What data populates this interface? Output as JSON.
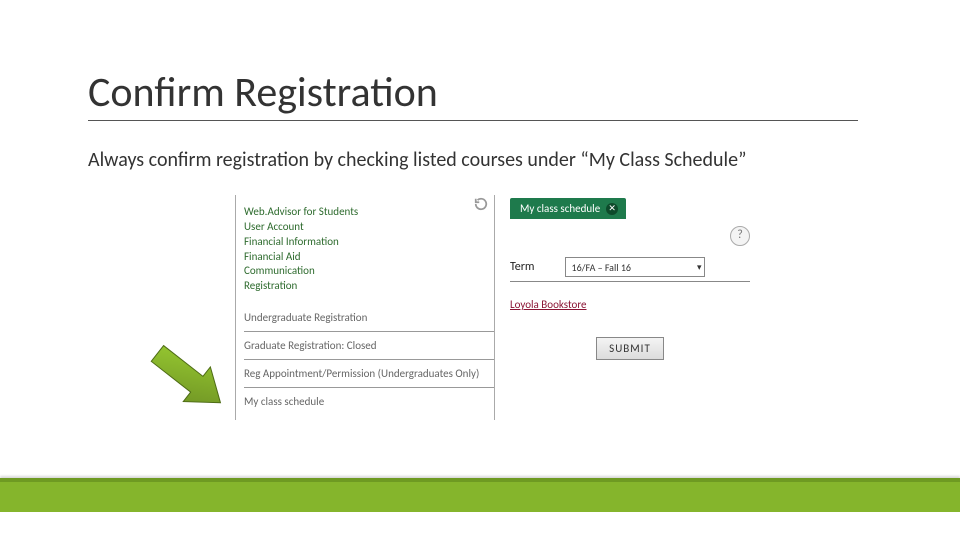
{
  "title": "Confirm Registration",
  "subtitle": "Always confirm registration by checking listed courses under “My Class Schedule”",
  "left_panel": {
    "links": [
      "Web.Advisor for Students",
      "User Account",
      "Financial Information",
      "Financial Aid",
      "Communication",
      "Registration"
    ],
    "rows": [
      "Undergraduate Registration",
      "Graduate Registration: Closed",
      "Reg Appointment/Permission (Undergraduates Only)",
      "My class schedule"
    ]
  },
  "right_panel": {
    "tab_label": "My class schedule",
    "term_label": "Term",
    "term_value": "16/FA – Fall 16",
    "bookstore_link": "Loyola Bookstore",
    "submit_label": "SUBMIT"
  }
}
